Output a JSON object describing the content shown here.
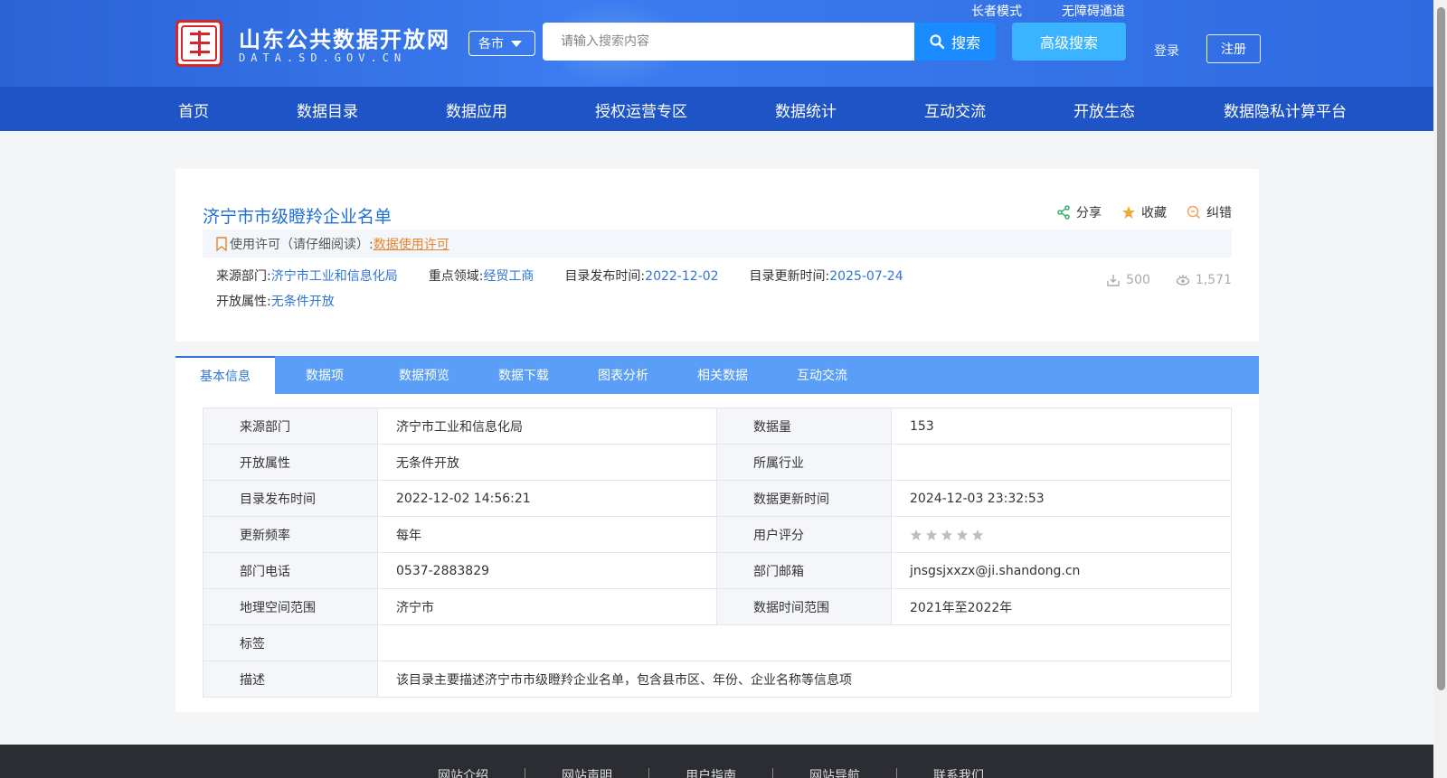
{
  "site": {
    "title": "山东公共数据开放网",
    "subtitle": "DATA.SD.GOV.CN",
    "city_select": "各市",
    "search_placeholder": "请输入搜索内容",
    "search_label": "搜索",
    "advanced_search": "高级搜索",
    "elder_mode": "长者模式",
    "accessible": "无障碍通道",
    "login": "登录",
    "register": "注册",
    "brand_color": "#2a63d4"
  },
  "nav": [
    "首页",
    "数据目录",
    "数据应用",
    "授权运营专区",
    "数据统计",
    "互动交流",
    "开放生态",
    "数据隐私计算平台"
  ],
  "dataset": {
    "title": "济宁市市级瞪羚企业名单",
    "actions": {
      "share": "分享",
      "favorite": "收藏",
      "correct": "纠错"
    },
    "license_label": "使用许可（请仔细阅读）:",
    "license_link": "数据使用许可",
    "meta": {
      "source_label": "来源部门:",
      "source": "济宁市工业和信息化局",
      "field_label": "重点领域:",
      "field": "经贸工商",
      "pub_label": "目录发布时间:",
      "pub": "2022-12-02",
      "upd_label": "目录更新时间:",
      "upd": "2025-07-24",
      "open_label": "开放属性:",
      "open": "无条件开放"
    },
    "downloads": "500",
    "views": "1,571"
  },
  "tabs": [
    "基本信息",
    "数据项",
    "数据预览",
    "数据下载",
    "图表分析",
    "相关数据",
    "互动交流"
  ],
  "info": {
    "r1": {
      "k1": "来源部门",
      "v1": "济宁市工业和信息化局",
      "k2": "数据量",
      "v2": "153"
    },
    "r2": {
      "k1": "开放属性",
      "v1": "无条件开放",
      "k2": "所属行业",
      "v2": ""
    },
    "r3": {
      "k1": "目录发布时间",
      "v1": "2022-12-02 14:56:21",
      "k2": "数据更新时间",
      "v2": "2024-12-03 23:32:53"
    },
    "r4": {
      "k1": "更新频率",
      "v1": "每年",
      "k2": "用户评分",
      "rating": 0
    },
    "r5": {
      "k1": "部门电话",
      "v1": "0537-2883829",
      "k2": "部门邮箱",
      "v2": "jnsgsjxxzx@ji.shandong.cn"
    },
    "r6": {
      "k1": "地理空间范围",
      "v1": "济宁市",
      "k2": "数据时间范围",
      "v2": "2021年至2022年"
    },
    "r7": {
      "k1": "标签",
      "v1": ""
    },
    "r8": {
      "k1": "描述",
      "v1": "该目录主要描述济宁市市级瞪羚企业名单，包含县市区、年份、企业名称等信息项"
    }
  },
  "footer": [
    "网站介绍",
    "网站声明",
    "用户指南",
    "网站导航",
    "联系我们"
  ]
}
